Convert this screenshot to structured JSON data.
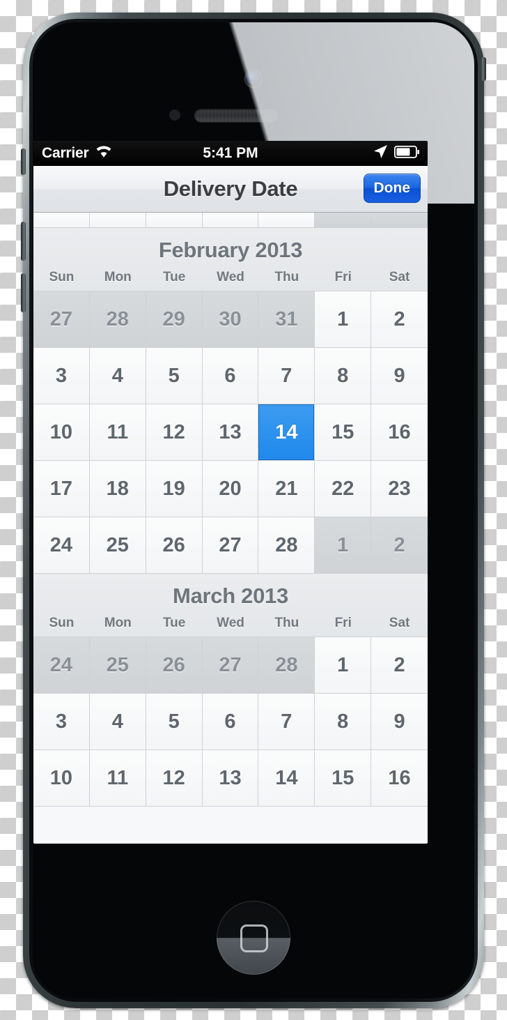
{
  "status_bar": {
    "carrier": "Carrier",
    "time": "5:41 PM",
    "wifi_icon": "wifi-icon",
    "location_icon": "location-arrow-icon",
    "battery_icon": "battery-icon",
    "battery_level_pct": 70
  },
  "nav_bar": {
    "title": "Delivery Date",
    "done_label": "Done",
    "done_color": "#1a66df"
  },
  "calendar": {
    "weekday_labels": [
      "Sun",
      "Mon",
      "Tue",
      "Wed",
      "Thu",
      "Fri",
      "Sat"
    ],
    "selected_day": "14",
    "selected_color": "#2d92ee",
    "partial_row_above": [
      "",
      "",
      "",
      "",
      "",
      "",
      ""
    ],
    "months": [
      {
        "title": "February 2013",
        "weeks": [
          [
            {
              "d": "27",
              "adjacent": true
            },
            {
              "d": "28",
              "adjacent": true
            },
            {
              "d": "29",
              "adjacent": true
            },
            {
              "d": "30",
              "adjacent": true
            },
            {
              "d": "31",
              "adjacent": true
            },
            {
              "d": "1"
            },
            {
              "d": "2"
            }
          ],
          [
            {
              "d": "3"
            },
            {
              "d": "4"
            },
            {
              "d": "5"
            },
            {
              "d": "6"
            },
            {
              "d": "7"
            },
            {
              "d": "8"
            },
            {
              "d": "9"
            }
          ],
          [
            {
              "d": "10"
            },
            {
              "d": "11"
            },
            {
              "d": "12"
            },
            {
              "d": "13"
            },
            {
              "d": "14",
              "selected": true
            },
            {
              "d": "15"
            },
            {
              "d": "16"
            }
          ],
          [
            {
              "d": "17"
            },
            {
              "d": "18"
            },
            {
              "d": "19"
            },
            {
              "d": "20"
            },
            {
              "d": "21"
            },
            {
              "d": "22"
            },
            {
              "d": "23"
            }
          ],
          [
            {
              "d": "24"
            },
            {
              "d": "25"
            },
            {
              "d": "26"
            },
            {
              "d": "27"
            },
            {
              "d": "28"
            },
            {
              "d": "1",
              "adjacent": true
            },
            {
              "d": "2",
              "adjacent": true
            }
          ]
        ]
      },
      {
        "title": "March 2013",
        "weeks": [
          [
            {
              "d": "24",
              "adjacent": true
            },
            {
              "d": "25",
              "adjacent": true
            },
            {
              "d": "26",
              "adjacent": true
            },
            {
              "d": "27",
              "adjacent": true
            },
            {
              "d": "28",
              "adjacent": true
            },
            {
              "d": "1"
            },
            {
              "d": "2"
            }
          ],
          [
            {
              "d": "3"
            },
            {
              "d": "4"
            },
            {
              "d": "5"
            },
            {
              "d": "6"
            },
            {
              "d": "7"
            },
            {
              "d": "8"
            },
            {
              "d": "9"
            }
          ],
          [
            {
              "d": "10"
            },
            {
              "d": "11"
            },
            {
              "d": "12"
            },
            {
              "d": "13"
            },
            {
              "d": "14"
            },
            {
              "d": "15"
            },
            {
              "d": "16"
            }
          ]
        ]
      }
    ]
  },
  "device": {
    "camera_icon": "camera-icon",
    "proximity_sensor_icon": "proximity-sensor-icon",
    "earpiece_icon": "earpiece-speaker-icon",
    "home_button_icon": "home-button-icon",
    "ring_switch": "ring-silent-switch",
    "volume_up": "volume-up-button",
    "volume_down": "volume-down-button",
    "power_button": "power-button"
  }
}
